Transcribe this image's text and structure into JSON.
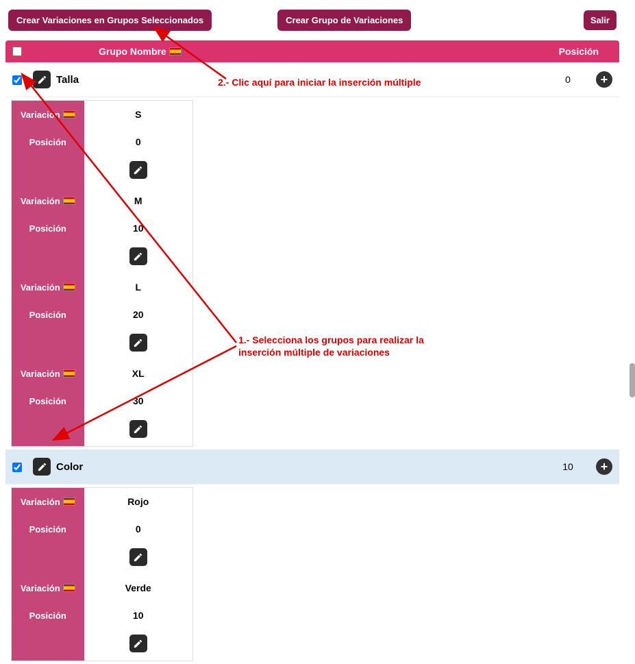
{
  "toolbar": {
    "create_in_groups": "Crear Variaciones en Grupos Seleccionados",
    "create_group": "Crear Grupo de Variaciones",
    "exit": "Salir"
  },
  "header": {
    "group_name": "Grupo Nombre",
    "position": "Posición"
  },
  "labels": {
    "variation": "Variación",
    "position": "Posición"
  },
  "groups": [
    {
      "name": "Talla",
      "position": "0",
      "checked": true,
      "highlight": false,
      "variations": [
        {
          "name": "S",
          "position": "0"
        },
        {
          "name": "M",
          "position": "10"
        },
        {
          "name": "L",
          "position": "20"
        },
        {
          "name": "XL",
          "position": "30"
        }
      ]
    },
    {
      "name": "Color",
      "position": "10",
      "checked": true,
      "highlight": true,
      "variations": [
        {
          "name": "Rojo",
          "position": "0"
        },
        {
          "name": "Verde",
          "position": "10"
        }
      ]
    }
  ],
  "annotations": {
    "note2": "2.- Clic aquí para iniciar la inserción múltiple",
    "note1": "1.- Selecciona los grupos para realizar la inserción múltiple de variaciones"
  },
  "colors": {
    "brand_dark": "#8f1a4b",
    "brand_pink": "#da326d",
    "brand_cell": "#c6467a",
    "highlight_row": "#dceaf5",
    "annotation": "#e00000"
  }
}
